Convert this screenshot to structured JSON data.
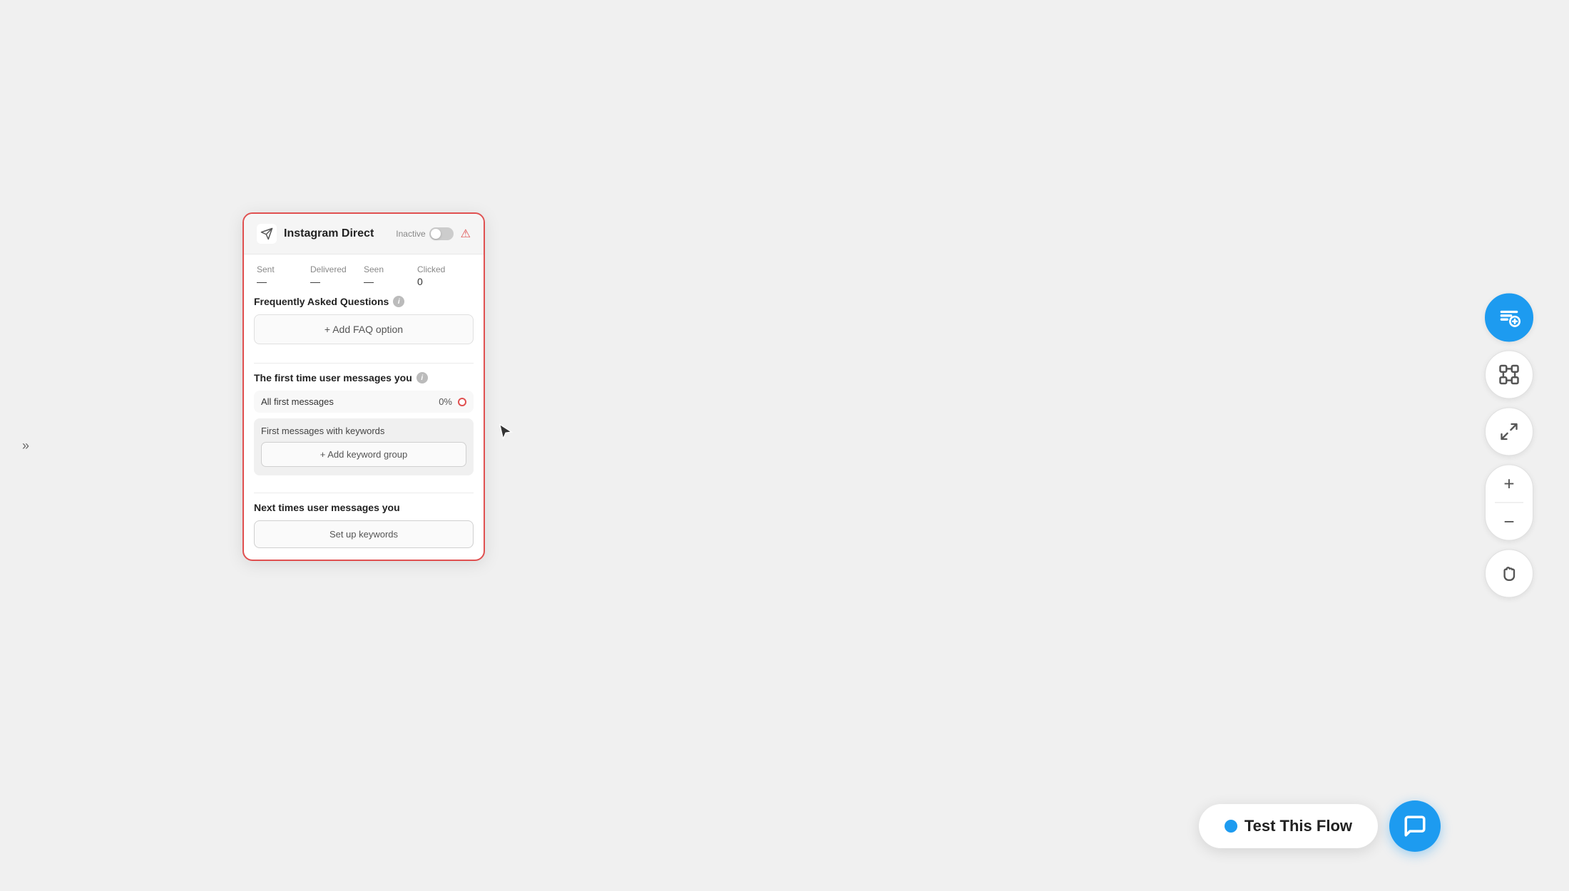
{
  "canvas": {
    "background": "#f0f0f0"
  },
  "collapse_btn": {
    "icon": "»",
    "label": "collapse"
  },
  "card": {
    "title": "Instagram Direct",
    "status": "Inactive",
    "toggle_active": false,
    "warning": "⚠",
    "stats": [
      {
        "label": "Sent",
        "value": "—"
      },
      {
        "label": "Delivered",
        "value": "—"
      },
      {
        "label": "Seen",
        "value": "—"
      },
      {
        "label": "Clicked",
        "value": "0"
      }
    ],
    "faq_section": {
      "title": "Frequently Asked Questions",
      "add_btn": "+ Add FAQ option"
    },
    "first_time_section": {
      "title": "The first time user messages you",
      "all_first_messages": {
        "label": "All first messages",
        "percent": "0%"
      },
      "keywords_section": {
        "label": "First messages with keywords",
        "add_btn": "+ Add keyword group"
      }
    },
    "next_times_section": {
      "title": "Next times user messages you",
      "setup_btn": "Set up keywords"
    }
  },
  "toolbar": {
    "add_btn": "+",
    "flow_btn": "⊞",
    "compress_btn": "⤡",
    "zoom_in": "+",
    "zoom_out": "−",
    "hand_btn": "✋"
  },
  "bottom": {
    "test_flow_label": "Test This Flow",
    "chat_icon": "💬"
  }
}
